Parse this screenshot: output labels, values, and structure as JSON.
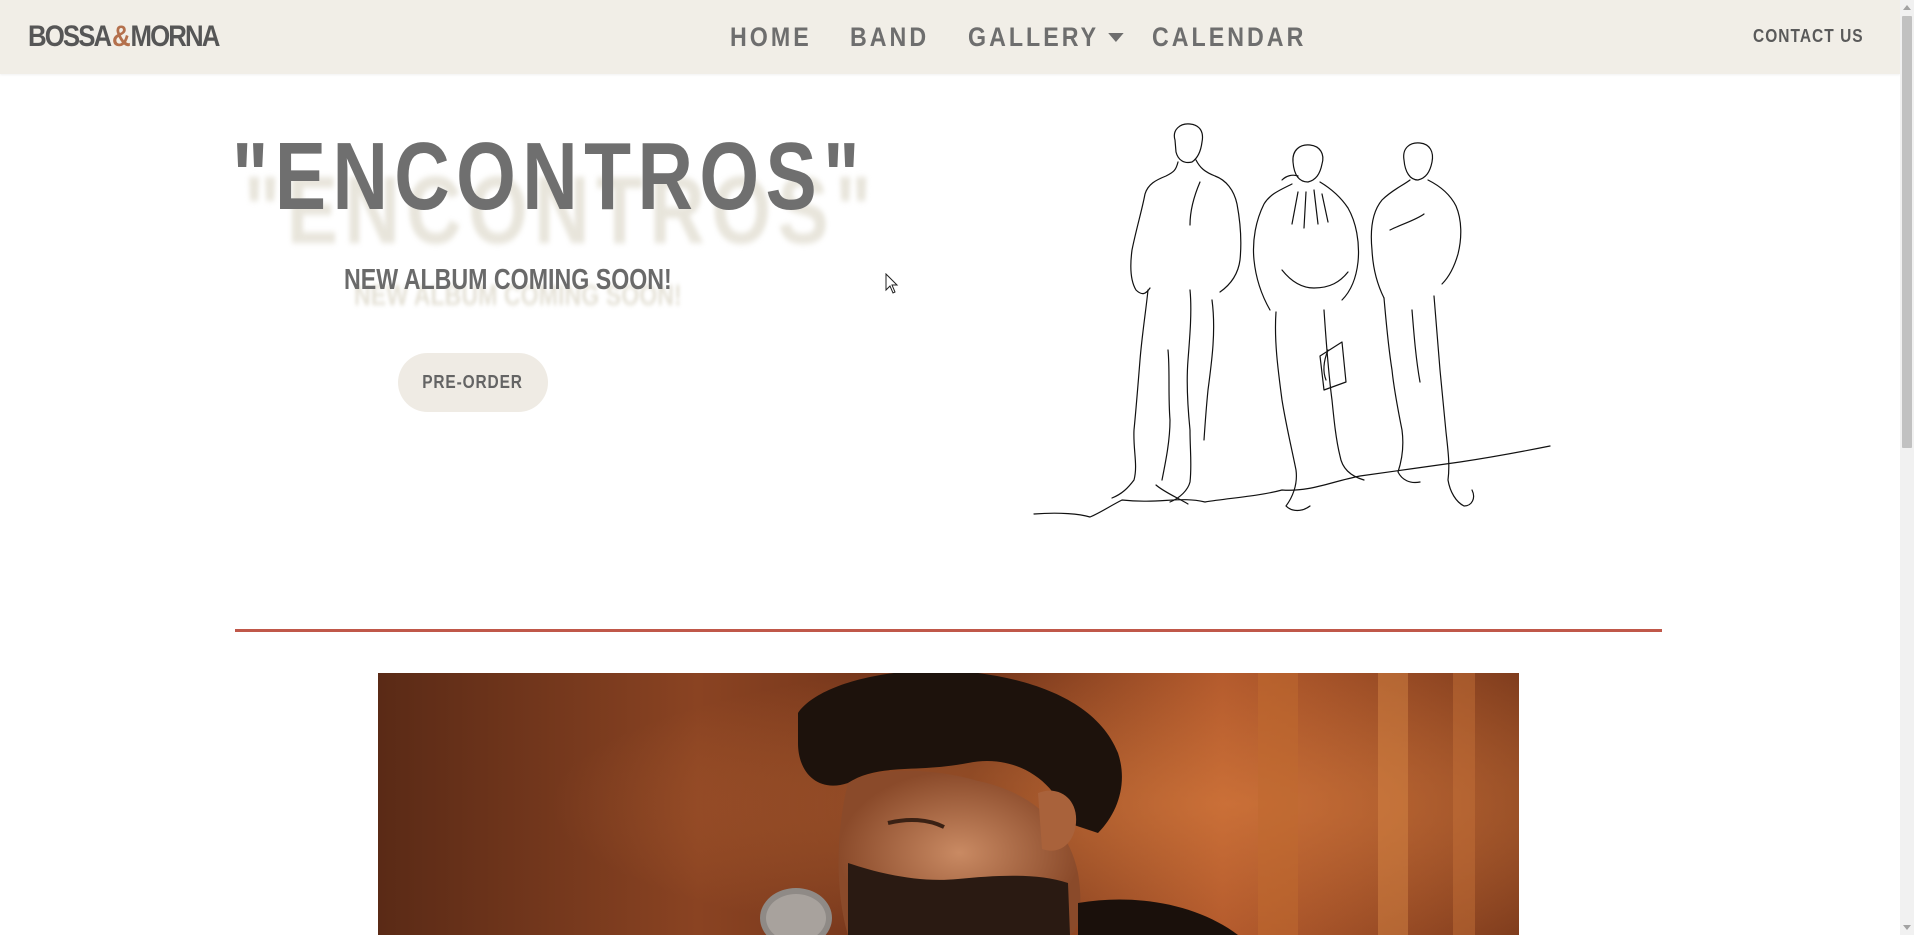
{
  "brand": {
    "part1": "BOSSA",
    "amp": "&",
    "part2": "MORNA"
  },
  "nav": {
    "items": [
      {
        "label": "HOME"
      },
      {
        "label": "BAND"
      },
      {
        "label": "GALLERY"
      },
      {
        "label": "CALENDAR"
      }
    ],
    "contact": "CONTACT US"
  },
  "hero": {
    "title": "\"ENCONTROS\"",
    "subtitle": "NEW ALBUM COMING SOON!",
    "preorder": "PRE-ORDER"
  },
  "colors": {
    "navbar_bg": "#f1eee7",
    "text_gray": "#6f6f6f",
    "brand_amp": "#b4704c",
    "divider": "#c0584a",
    "button_bg": "#efebe4"
  }
}
